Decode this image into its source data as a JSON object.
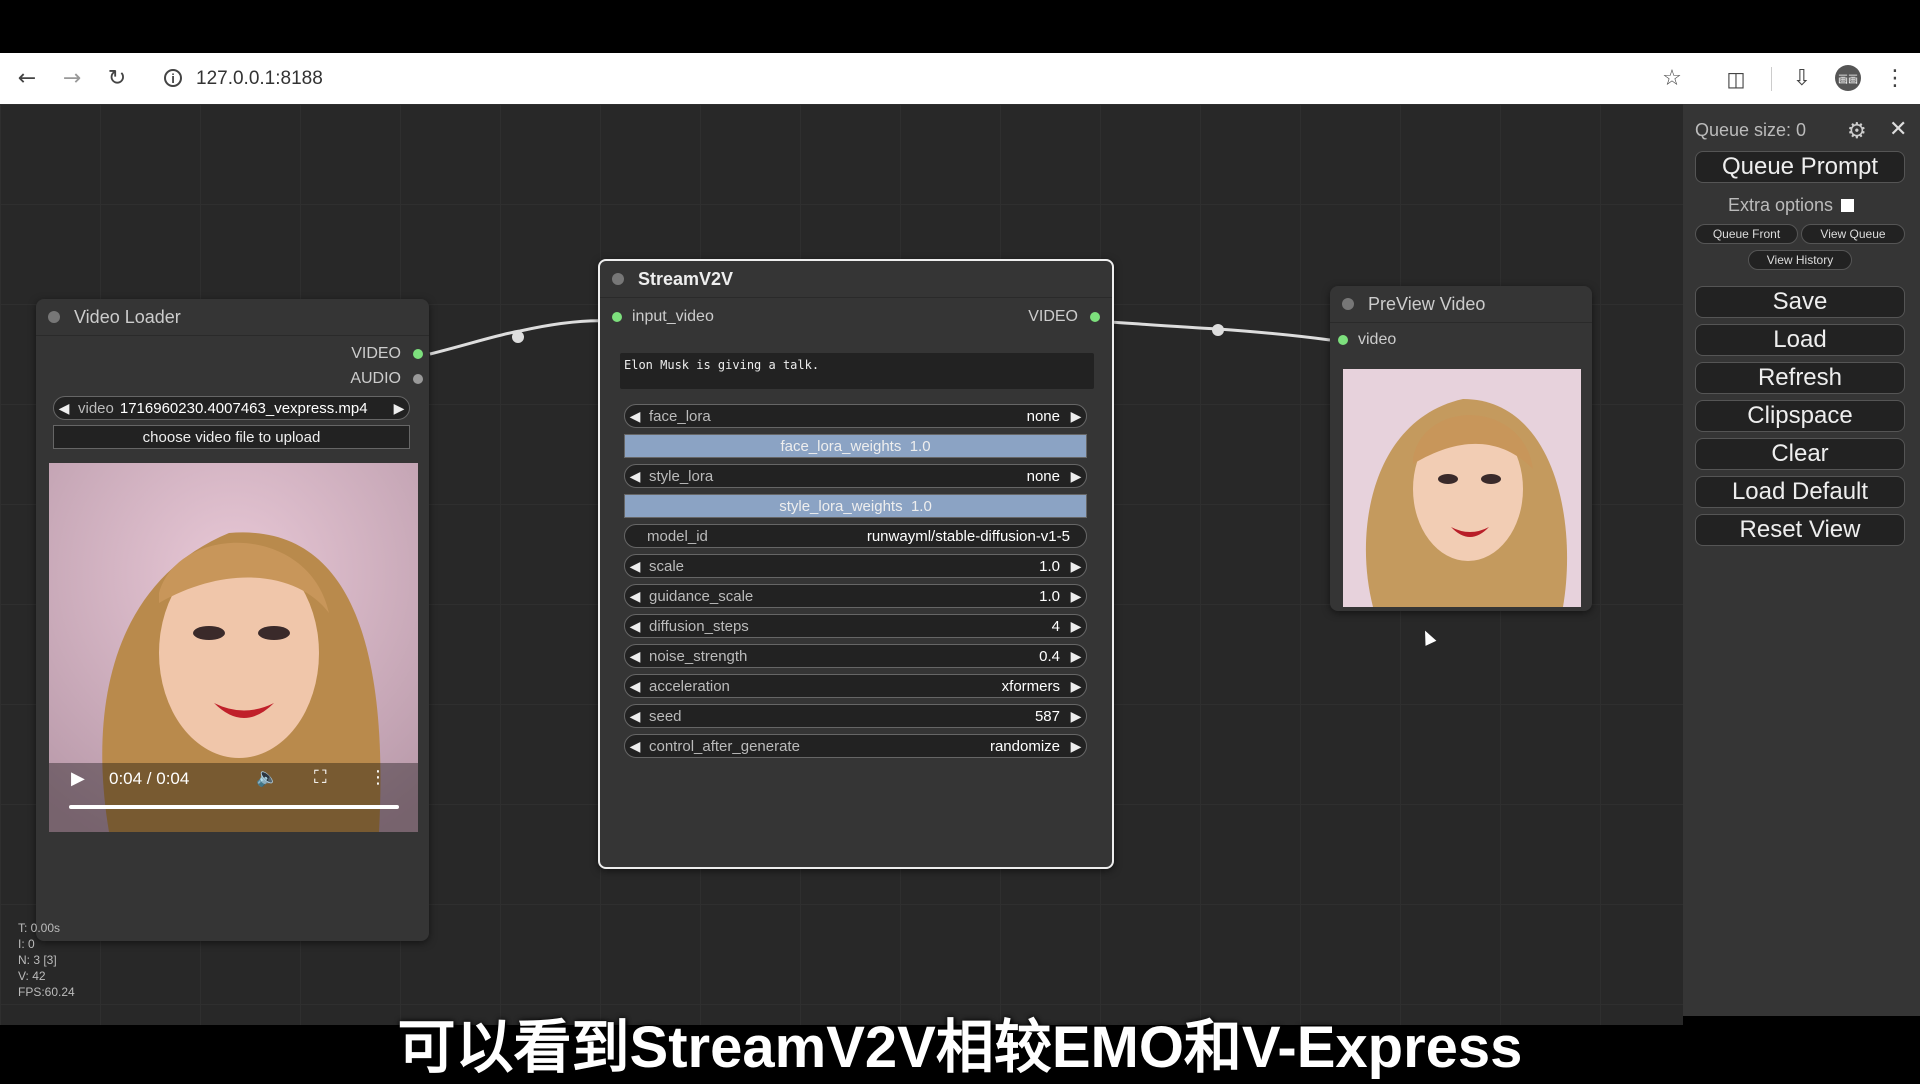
{
  "browser": {
    "url": "127.0.0.1:8188",
    "profile_initials": "画画"
  },
  "nodes": {
    "video_loader": {
      "title": "Video Loader",
      "outputs": [
        "VIDEO",
        "AUDIO"
      ],
      "video_widget_label": "video",
      "video_widget_value": "1716960230.4007463_vexpress.mp4",
      "upload_button": "choose video file to upload",
      "player_time": "0:04 / 0:04"
    },
    "streamv2v": {
      "title": "StreamV2V",
      "input": "input_video",
      "output": "VIDEO",
      "prompt": "Elon Musk is giving a talk.",
      "widgets": [
        {
          "name": "face_lora",
          "value": "none",
          "type": "combo"
        },
        {
          "name": "face_lora_weights",
          "value": "1.0",
          "type": "slider"
        },
        {
          "name": "style_lora",
          "value": "none",
          "type": "combo"
        },
        {
          "name": "style_lora_weights",
          "value": "1.0",
          "type": "slider"
        },
        {
          "name": "model_id",
          "value": "runwayml/stable-diffusion-v1-5",
          "type": "text"
        },
        {
          "name": "scale",
          "value": "1.0",
          "type": "number"
        },
        {
          "name": "guidance_scale",
          "value": "1.0",
          "type": "number"
        },
        {
          "name": "diffusion_steps",
          "value": "4",
          "type": "number"
        },
        {
          "name": "noise_strength",
          "value": "0.4",
          "type": "number"
        },
        {
          "name": "acceleration",
          "value": "xformers",
          "type": "combo"
        },
        {
          "name": "seed",
          "value": "587",
          "type": "number"
        },
        {
          "name": "control_after_generate",
          "value": "randomize",
          "type": "combo"
        }
      ]
    },
    "preview_video": {
      "title": "PreView Video",
      "input": "video"
    }
  },
  "panel": {
    "queue_size": "Queue size: 0",
    "queue_prompt": "Queue Prompt",
    "extra_options": "Extra options",
    "queue_front": "Queue Front",
    "view_queue": "View Queue",
    "view_history": "View History",
    "buttons": [
      "Save",
      "Load",
      "Refresh",
      "Clipspace",
      "Clear",
      "Load Default",
      "Reset View"
    ]
  },
  "stats": {
    "t": "T: 0.00s",
    "i": "I: 0",
    "n": "N: 3 [3]",
    "v": "V: 42",
    "fps": "FPS:60.24"
  },
  "subtitle": "可以看到StreamV2V相较EMO和V-Express",
  "colors": {
    "canvas": "#282828",
    "node": "#353535",
    "slot_green": "#7de07d",
    "slider": "#8ba3c4"
  }
}
